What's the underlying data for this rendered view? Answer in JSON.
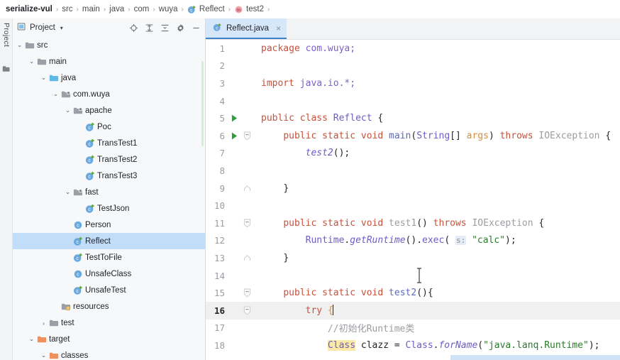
{
  "breadcrumb": {
    "items": [
      {
        "label": "serialize-vul",
        "icon": "none",
        "root": true
      },
      {
        "label": "src",
        "icon": "none"
      },
      {
        "label": "main",
        "icon": "none"
      },
      {
        "label": "java",
        "icon": "none"
      },
      {
        "label": "com",
        "icon": "none"
      },
      {
        "label": "wuya",
        "icon": "none"
      },
      {
        "label": "Reflect",
        "icon": "java-class-icon"
      },
      {
        "label": "test2",
        "icon": "java-method-icon"
      }
    ],
    "separator": "›"
  },
  "left_strip": {
    "tab_label": "Project",
    "tab_icon": "project-structure-icon"
  },
  "project_panel": {
    "title": "Project",
    "title_icon": "project-icon",
    "caret": "▾",
    "tools": [
      {
        "name": "locate-file-icon",
        "title": "Select Opened File"
      },
      {
        "name": "expand-all-icon",
        "title": "Expand All"
      },
      {
        "name": "collapse-all-icon",
        "title": "Collapse All"
      },
      {
        "name": "settings-gear-icon",
        "title": "Settings"
      },
      {
        "name": "hide-panel-icon",
        "title": "Hide"
      }
    ],
    "tree": [
      {
        "label": "src",
        "depth": 1,
        "arrow": "⌄",
        "icon": "folder-source",
        "selected": false
      },
      {
        "label": "main",
        "depth": 2,
        "arrow": "⌄",
        "icon": "folder-source",
        "selected": false
      },
      {
        "label": "java",
        "depth": 3,
        "arrow": "⌄",
        "icon": "folder-java",
        "selected": false
      },
      {
        "label": "com.wuya",
        "depth": 4,
        "arrow": "⌄",
        "icon": "folder-package",
        "selected": false
      },
      {
        "label": "apache",
        "depth": 5,
        "arrow": "⌄",
        "icon": "folder-package",
        "selected": false
      },
      {
        "label": "Poc",
        "depth": 6,
        "arrow": "",
        "icon": "java-class-run",
        "selected": false
      },
      {
        "label": "TransTest1",
        "depth": 6,
        "arrow": "",
        "icon": "java-class-run",
        "selected": false
      },
      {
        "label": "TransTest2",
        "depth": 6,
        "arrow": "",
        "icon": "java-class-run",
        "selected": false
      },
      {
        "label": "TransTest3",
        "depth": 6,
        "arrow": "",
        "icon": "java-class-run",
        "selected": false
      },
      {
        "label": "fast",
        "depth": 5,
        "arrow": "⌄",
        "icon": "folder-package",
        "selected": false
      },
      {
        "label": "TestJson",
        "depth": 6,
        "arrow": "",
        "icon": "java-class-run",
        "selected": false
      },
      {
        "label": "Person",
        "depth": 5,
        "arrow": "",
        "icon": "java-class",
        "selected": false
      },
      {
        "label": "Reflect",
        "depth": 5,
        "arrow": "",
        "icon": "java-class-run",
        "selected": true
      },
      {
        "label": "TestToFile",
        "depth": 5,
        "arrow": "",
        "icon": "java-class-run",
        "selected": false
      },
      {
        "label": "UnsafeClass",
        "depth": 5,
        "arrow": "",
        "icon": "java-class",
        "selected": false
      },
      {
        "label": "UnsafeTest",
        "depth": 5,
        "arrow": "",
        "icon": "java-class-run",
        "selected": false
      },
      {
        "label": "resources",
        "depth": 4,
        "arrow": "",
        "icon": "folder-resources",
        "selected": false
      },
      {
        "label": "test",
        "depth": 3,
        "arrow": "›",
        "icon": "folder-source",
        "selected": false
      },
      {
        "label": "target",
        "depth": 2,
        "arrow": "⌄",
        "icon": "folder-excluded",
        "selected": false
      },
      {
        "label": "classes",
        "depth": 3,
        "arrow": "⌄",
        "icon": "folder-excluded",
        "selected": false
      }
    ]
  },
  "editor": {
    "tab": {
      "label": "Reflect.java",
      "icon": "java-class-run",
      "close_label": "×"
    },
    "lines": [
      {
        "num": "1",
        "run": false,
        "fold": "",
        "current": false
      },
      {
        "num": "2",
        "run": false,
        "fold": "",
        "current": false
      },
      {
        "num": "3",
        "run": false,
        "fold": "",
        "current": false
      },
      {
        "num": "4",
        "run": false,
        "fold": "",
        "current": false
      },
      {
        "num": "5",
        "run": true,
        "fold": "",
        "current": false
      },
      {
        "num": "6",
        "run": true,
        "fold": "minus",
        "current": false
      },
      {
        "num": "7",
        "run": false,
        "fold": "bar",
        "current": false
      },
      {
        "num": "8",
        "run": false,
        "fold": "bar",
        "current": false
      },
      {
        "num": "9",
        "run": false,
        "fold": "end",
        "current": false
      },
      {
        "num": "10",
        "run": false,
        "fold": "",
        "current": false
      },
      {
        "num": "11",
        "run": false,
        "fold": "minus",
        "current": false
      },
      {
        "num": "12",
        "run": false,
        "fold": "bar",
        "current": false
      },
      {
        "num": "13",
        "run": false,
        "fold": "end",
        "current": false
      },
      {
        "num": "14",
        "run": false,
        "fold": "",
        "current": false
      },
      {
        "num": "15",
        "run": false,
        "fold": "minus",
        "current": false
      },
      {
        "num": "16",
        "run": false,
        "fold": "minus",
        "current": true
      },
      {
        "num": "17",
        "run": false,
        "fold": "bar",
        "current": false
      },
      {
        "num": "18",
        "run": false,
        "fold": "bar",
        "current": false
      }
    ],
    "source": {
      "l1": "package com.wuya;",
      "l2": "",
      "l3": "import java.io.*;",
      "l4": "",
      "l5": "public class Reflect {",
      "l6": "    public static void main(String[] args) throws IOException {",
      "l7": "        test2();",
      "l8": "",
      "l9": "    }",
      "l10": "",
      "l11": "    public static void test1() throws IOException {",
      "l12": "        Runtime.getRuntime().exec( s: \"calc\");",
      "l13": "    }",
      "l14": "",
      "l15": "    public static void test2(){",
      "l16": "        try {",
      "l17": "            //初始化Runtime类",
      "l18": "            Class clazz = Class.forName(\"java.lanq.Runtime\");"
    },
    "tokens": {
      "kw_package": "package",
      "pkg_comwuya": " com.wuya;",
      "kw_import": "import",
      "pkg_javaio": " java.io.*;",
      "kw_public": "public",
      "kw_class": "class",
      "cls_Reflect": "Reflect",
      "brace_open": "{",
      "brace_close": "}",
      "kw_static": "static",
      "kw_void": "void",
      "mth_main": "main",
      "paren_open": "(",
      "cls_String": "String",
      "brackets": "[]",
      "param_args": "args",
      "paren_close": ")",
      "kw_throws": "throws",
      "typ_IOException": "IOException",
      "call_test2": "test2",
      "semi_parens": "();",
      "mth_test1": "test1",
      "cls_Runtime": "Runtime",
      "dot": ".",
      "mth_getRuntime": "getRuntime",
      "mth_exec": "exec",
      "hint_s": "s:",
      "str_calc": "\"calc\"",
      "mth_test2": "test2",
      "kw_try": "try",
      "comment_init": "//初始化Runtime类",
      "cls_Class": "Class",
      "ident_clazz": "clazz",
      "equals": "=",
      "mth_forName": "forName",
      "str_runtime": "\"java.lanq.Runtime\""
    }
  }
}
